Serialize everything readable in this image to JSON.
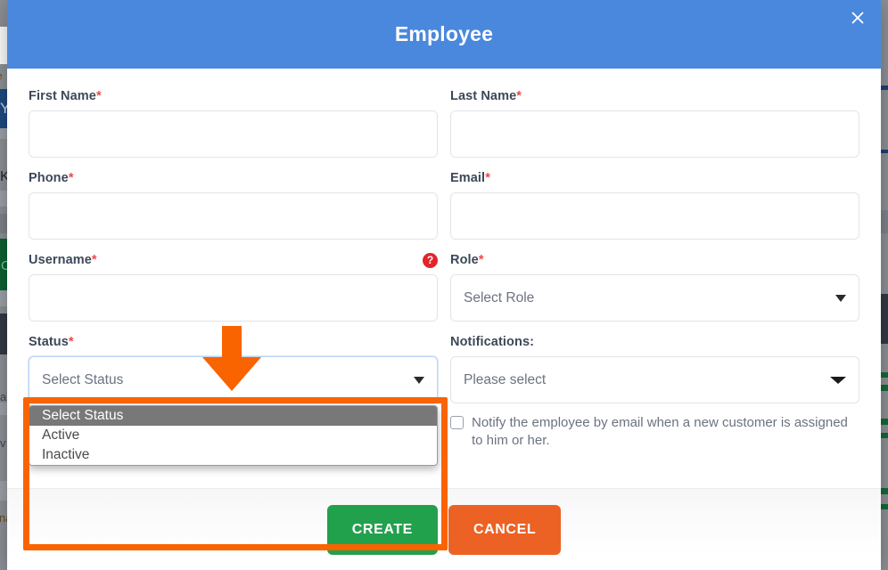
{
  "modal": {
    "title": "Employee",
    "close_icon": "close-icon"
  },
  "fields": {
    "first_name": {
      "label": "First Name",
      "required": "*",
      "value": "",
      "placeholder": ""
    },
    "last_name": {
      "label": "Last Name",
      "required": "*",
      "value": "",
      "placeholder": ""
    },
    "phone": {
      "label": "Phone",
      "required": "*",
      "value": "",
      "placeholder": ""
    },
    "email": {
      "label": "Email",
      "required": "*",
      "value": "",
      "placeholder": ""
    },
    "username": {
      "label": "Username",
      "required": "*",
      "value": "",
      "placeholder": "",
      "help_icon": "help-question-icon",
      "help_glyph": "?"
    },
    "role": {
      "label": "Role",
      "required": "*",
      "selected": "Select Role"
    },
    "status": {
      "label": "Status",
      "required": "*",
      "selected": "Select Status",
      "options": [
        "Select Status",
        "Active",
        "Inactive"
      ],
      "highlighted_index": 0,
      "open": true
    },
    "notifications": {
      "label": "Notifications:",
      "required": "",
      "selected": "Please select"
    }
  },
  "checkbox": {
    "checked": false,
    "label": "Notify the employee by email when a new customer is assigned to him or her."
  },
  "footer": {
    "create_label": "CREATE",
    "cancel_label": "CANCEL"
  },
  "annotation": {
    "color": "#f96300",
    "arrow_icon": "down-arrow-annotation-icon",
    "rect_icon": "highlight-rectangle-annotation"
  },
  "background": {
    "left_fragments": [
      "e",
      "Y",
      "K",
      "O",
      "ar",
      "v",
      "na"
    ],
    "right_fragments": [
      "",
      "",
      "",
      "",
      "",
      ""
    ]
  },
  "colors": {
    "header_blue": "#4a88dd",
    "create_green": "#22a14c",
    "cancel_orange": "#ec6224",
    "required_red": "#ec4a4a",
    "help_red": "#e3242b",
    "annotation_orange": "#f96300",
    "label_navy": "#3c4858"
  }
}
